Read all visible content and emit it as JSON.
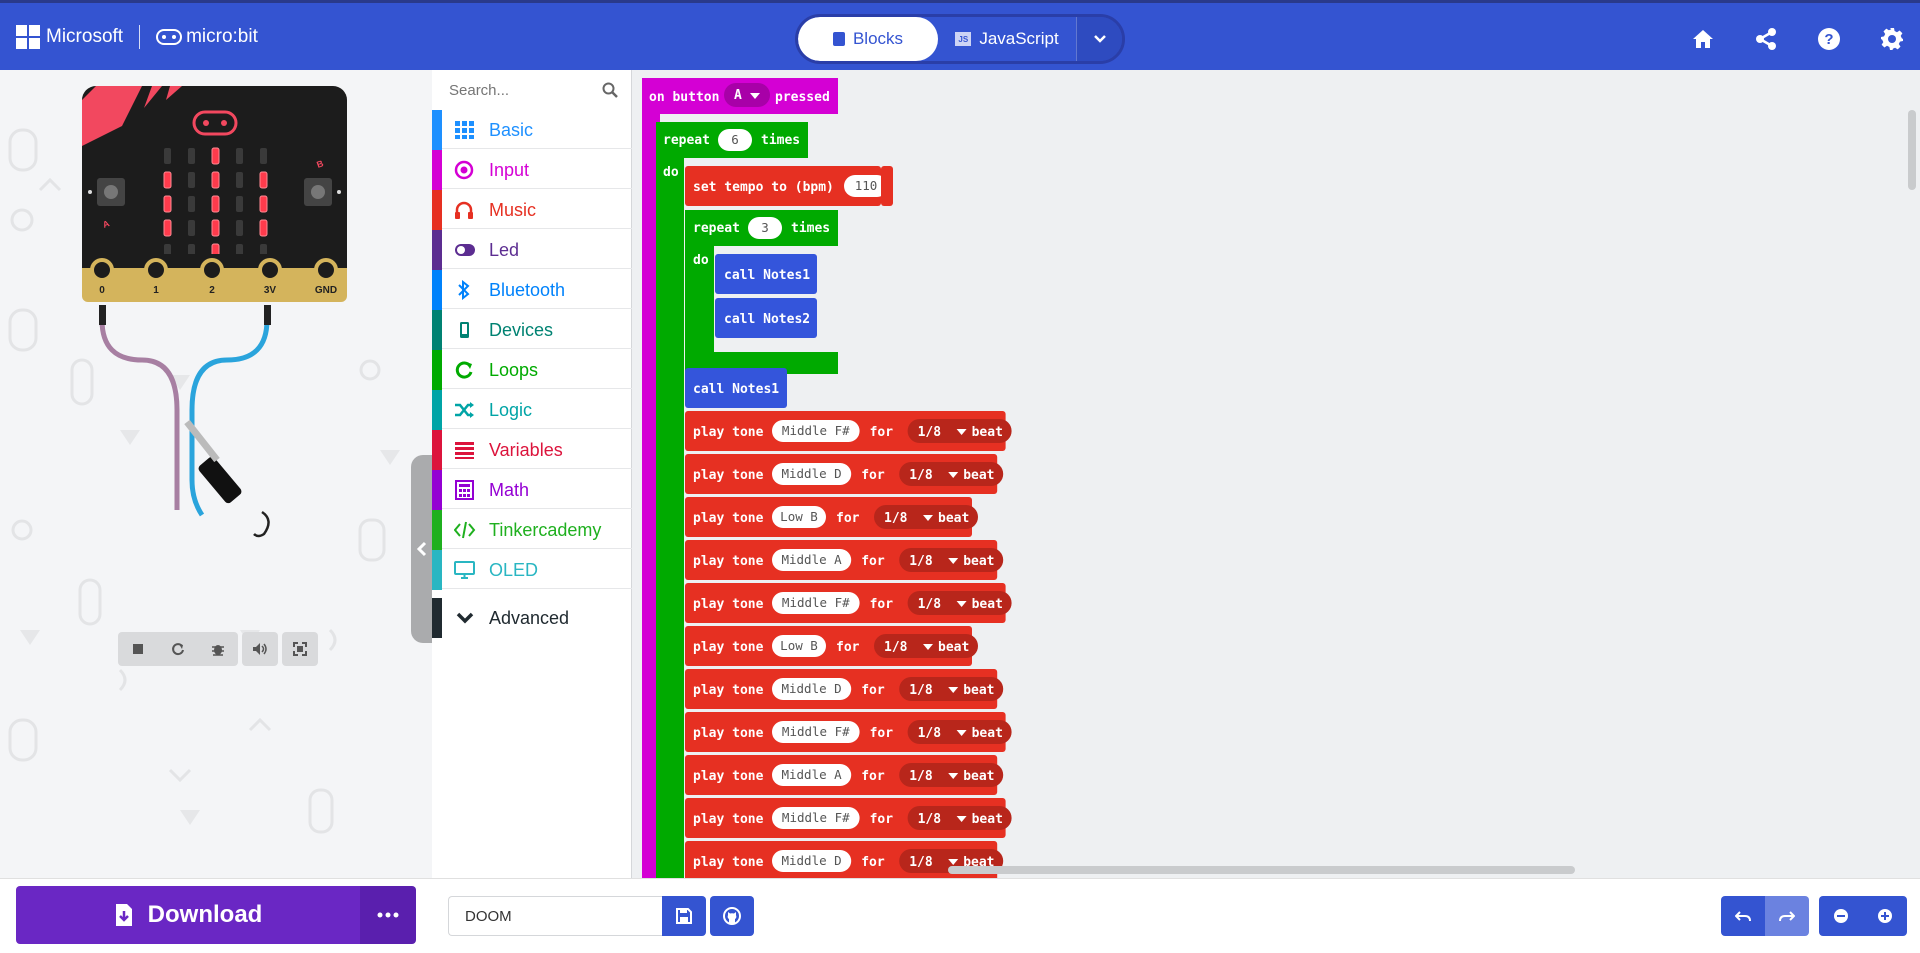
{
  "header": {
    "brand_ms": "Microsoft",
    "brand_product": "micro:bit",
    "modes": {
      "blocks": "Blocks",
      "javascript": "JavaScript"
    },
    "icons": [
      "home-icon",
      "share-icon",
      "help-icon",
      "settings-icon"
    ]
  },
  "toolbox": {
    "search_placeholder": "Search...",
    "categories": [
      {
        "label": "Basic",
        "color": "#1e90ff",
        "icon": "grid-icon"
      },
      {
        "label": "Input",
        "color": "#d400d4",
        "icon": "target-icon"
      },
      {
        "label": "Music",
        "color": "#e63022",
        "icon": "headphones-icon"
      },
      {
        "label": "Led",
        "color": "#5c2d91",
        "icon": "toggle-icon"
      },
      {
        "label": "Bluetooth",
        "color": "#0082fb",
        "icon": "bluetooth-icon"
      },
      {
        "label": "Devices",
        "color": "#008272",
        "icon": "phone-icon"
      },
      {
        "label": "Loops",
        "color": "#00aa00",
        "icon": "refresh-icon"
      },
      {
        "label": "Logic",
        "color": "#00a4a6",
        "icon": "shuffle-icon"
      },
      {
        "label": "Variables",
        "color": "#dc143c",
        "icon": "lines-icon"
      },
      {
        "label": "Math",
        "color": "#9400d3",
        "icon": "calculator-icon"
      },
      {
        "label": "Tinkercademy",
        "color": "#1fb01f",
        "icon": "code-icon"
      },
      {
        "label": "OLED",
        "color": "#29b6c2",
        "icon": "monitor-icon"
      }
    ],
    "advanced": "Advanced"
  },
  "blocks": {
    "event": {
      "prefix": "on button",
      "button": "A",
      "suffix": "pressed"
    },
    "repeat_outer": {
      "label": "repeat",
      "count": "6",
      "times": "times",
      "do": "do"
    },
    "tempo": {
      "label": "set tempo to (bpm)",
      "value": "110"
    },
    "repeat_inner": {
      "label": "repeat",
      "count": "3",
      "times": "times",
      "do": "do"
    },
    "calls_inner": [
      "call Notes1",
      "call Notes2"
    ],
    "call_after": "call Notes1",
    "tone_words": {
      "play": "play tone",
      "for": "for",
      "beat": "beat"
    },
    "tones": [
      {
        "note": "Middle F#",
        "dur": "1/8"
      },
      {
        "note": "Middle D",
        "dur": "1/8"
      },
      {
        "note": "Low B",
        "dur": "1/8"
      },
      {
        "note": "Middle A",
        "dur": "1/8"
      },
      {
        "note": "Middle F#",
        "dur": "1/8"
      },
      {
        "note": "Low B",
        "dur": "1/8"
      },
      {
        "note": "Middle D",
        "dur": "1/8"
      },
      {
        "note": "Middle F#",
        "dur": "1/8"
      },
      {
        "note": "Middle A",
        "dur": "1/8"
      },
      {
        "note": "Middle F#",
        "dur": "1/8"
      },
      {
        "note": "Middle D",
        "dur": "1/8"
      }
    ]
  },
  "simulator": {
    "pins": [
      "0",
      "1",
      "2",
      "3V",
      "GND"
    ],
    "buttons": [
      "A",
      "B"
    ],
    "led_on": [
      [
        0,
        2
      ],
      [
        1,
        0
      ],
      [
        1,
        2
      ],
      [
        1,
        4
      ],
      [
        2,
        0
      ],
      [
        2,
        2
      ],
      [
        2,
        4
      ],
      [
        3,
        0
      ],
      [
        3,
        2
      ],
      [
        3,
        4
      ],
      [
        4,
        2
      ]
    ]
  },
  "footer": {
    "download": "Download",
    "project_name": "DOOM"
  },
  "colors": {
    "header": "#3454d1",
    "event_block": "#d400d4",
    "loop_block": "#00aa00",
    "music_block": "#e63022",
    "function_block": "#3455db",
    "download": "#6a27c4"
  }
}
